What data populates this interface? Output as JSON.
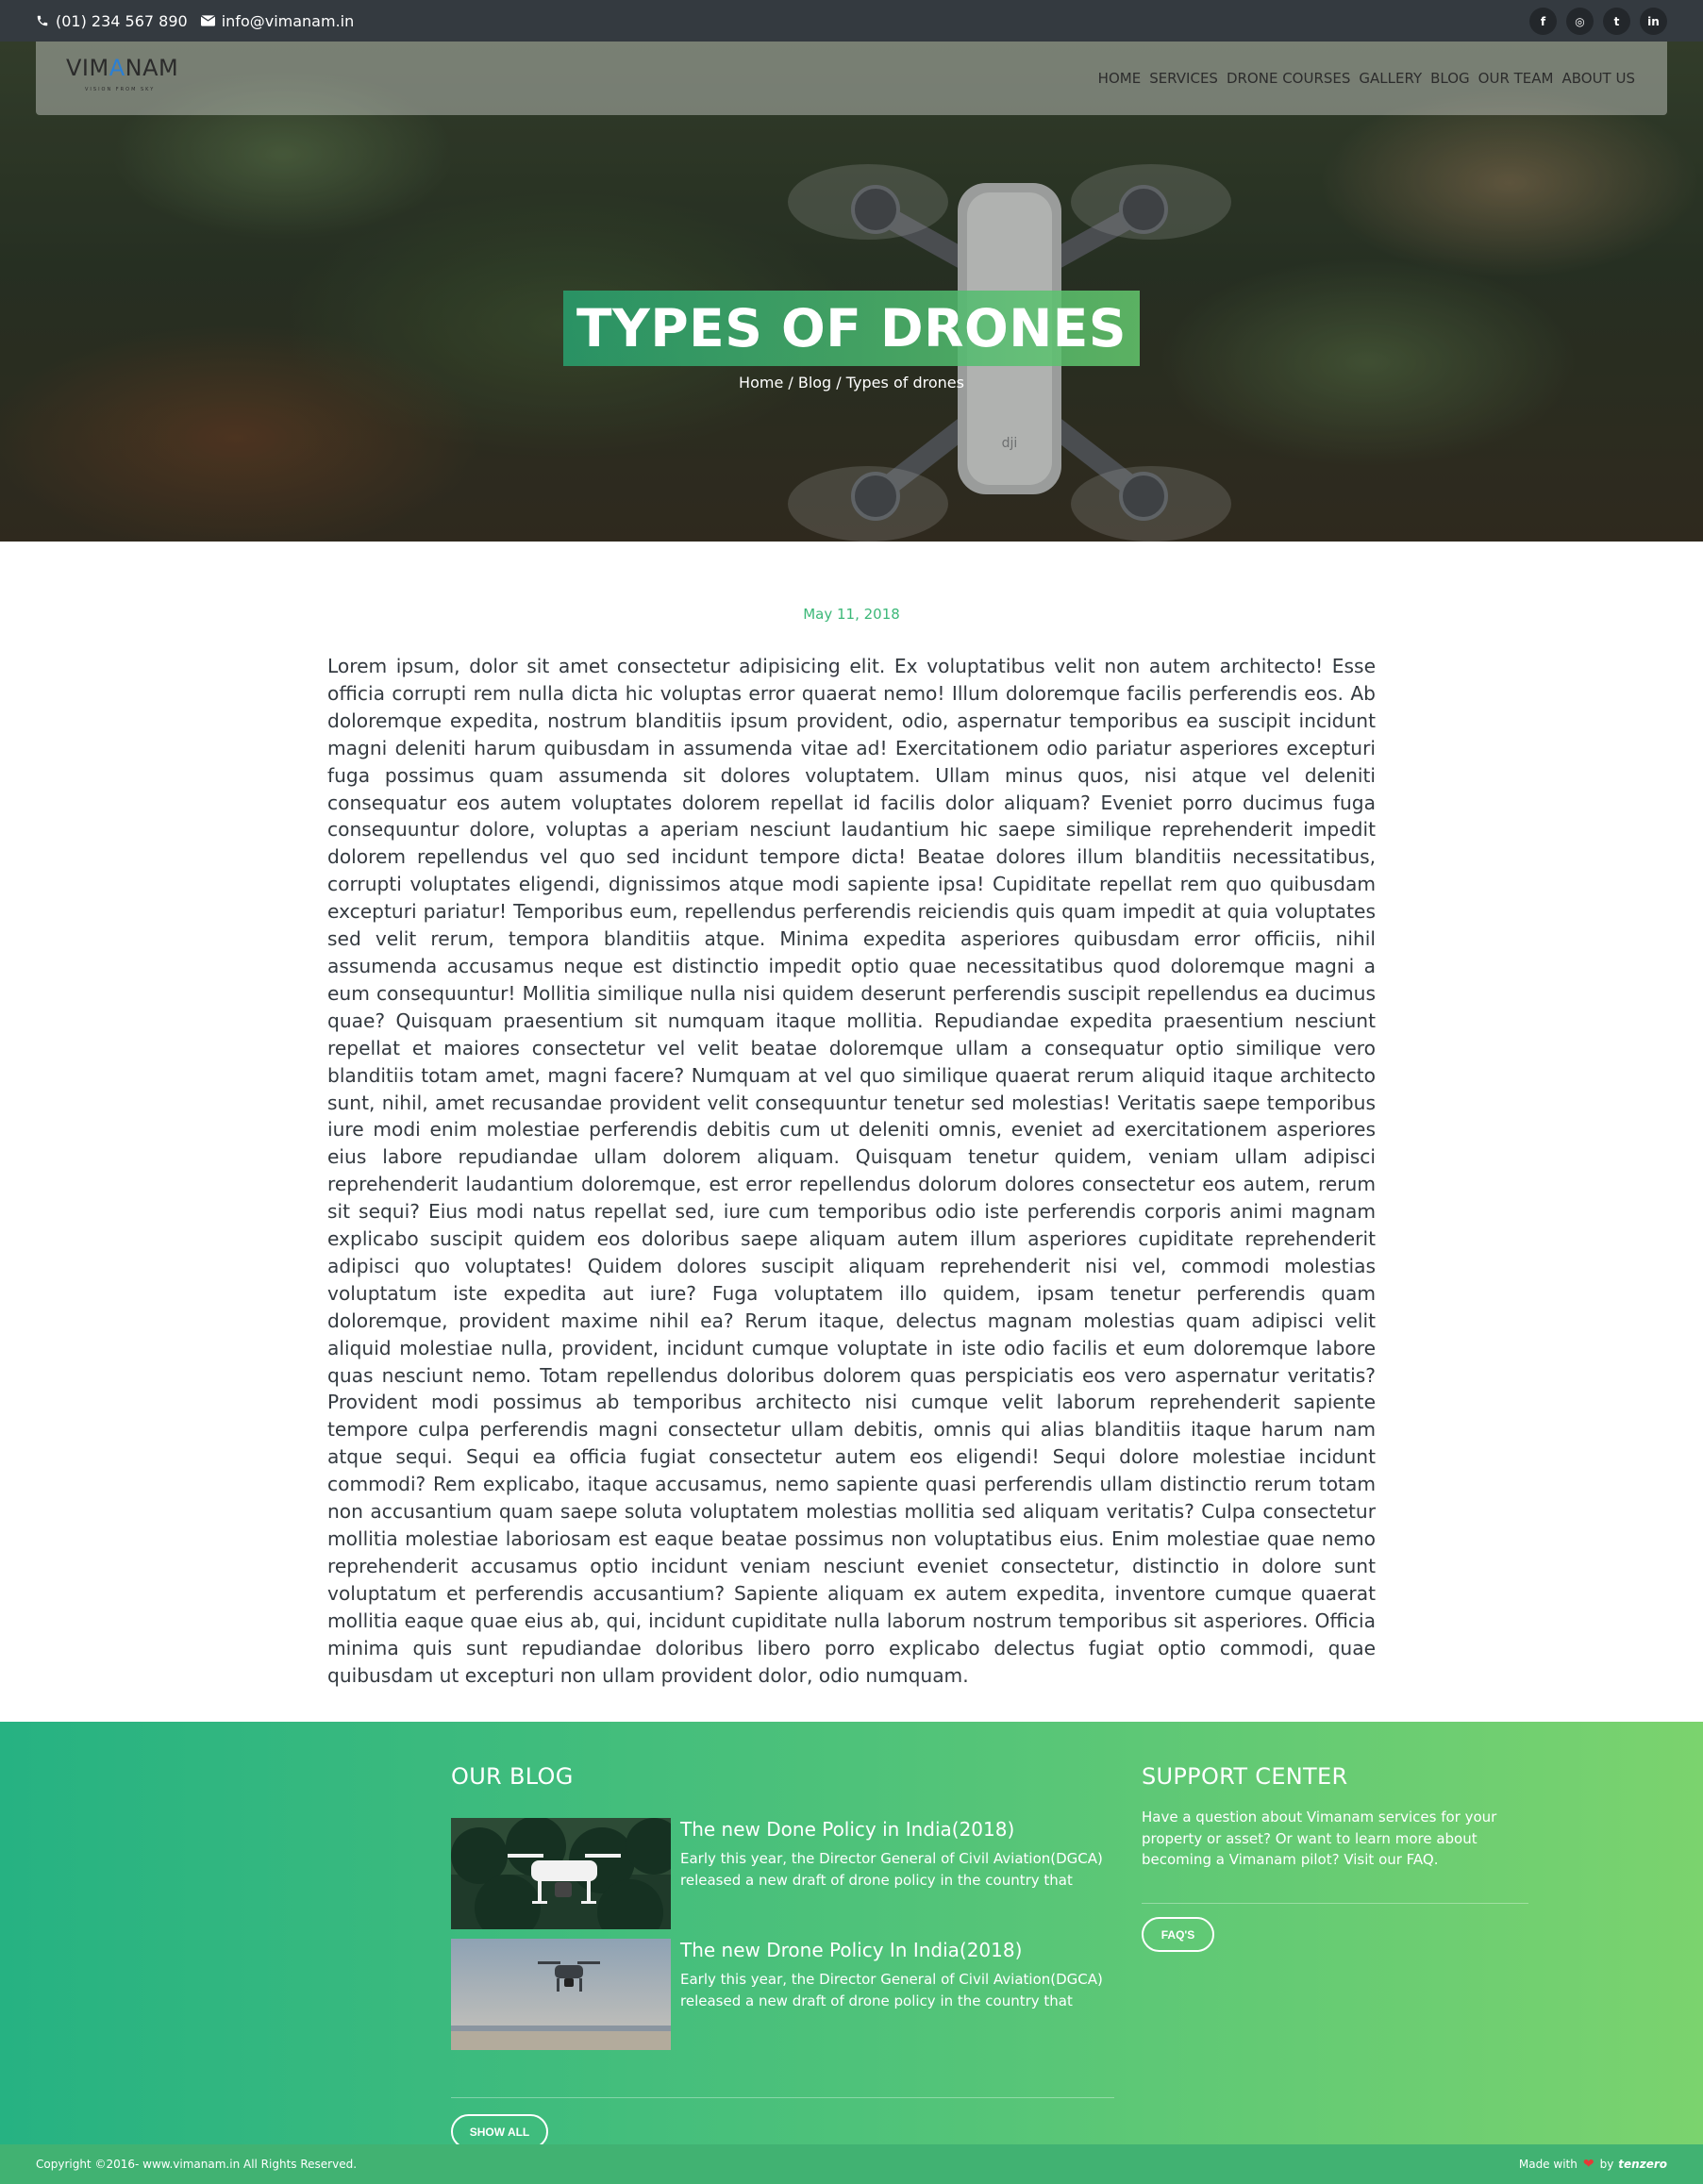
{
  "topbar": {
    "phone": "(01) 234 567 890",
    "email": "info@vimanam.in",
    "social": [
      {
        "icon": "facebook-icon",
        "glyph": "f"
      },
      {
        "icon": "instagram-icon",
        "glyph": "◎"
      },
      {
        "icon": "twitter-icon",
        "glyph": "t"
      },
      {
        "icon": "linkedin-icon",
        "glyph": "in"
      }
    ]
  },
  "brand": {
    "logo_text_left": "VIM",
    "logo_text_mid": "A",
    "logo_text_right": "NAM",
    "tagline": "VISION FROM SKY"
  },
  "nav": {
    "items": [
      "HOME",
      "SERVICES",
      "DRONE COURSES",
      "GALLERY",
      "BLOG",
      "OUR TEAM",
      "ABOUT US"
    ]
  },
  "hero": {
    "title": "TYPES OF DRONES",
    "breadcrumb": "Home / Blog / Types of drones"
  },
  "article": {
    "date": "May 11, 2018",
    "body": "Lorem ipsum, dolor sit amet consectetur adipisicing elit. Ex voluptatibus velit non autem architecto! Esse officia corrupti rem nulla dicta hic voluptas error quaerat nemo! Illum doloremque facilis perferendis eos. Ab doloremque expedita, nostrum blanditiis ipsum provident, odio, aspernatur temporibus ea suscipit incidunt magni deleniti harum quibusdam in assumenda vitae ad! Exercitationem odio pariatur asperiores excepturi fuga possimus quam assumenda sit dolores voluptatem. Ullam minus quos, nisi atque vel deleniti consequatur eos autem voluptates dolorem repellat id facilis dolor aliquam? Eveniet porro ducimus fuga consequuntur dolore, voluptas a aperiam nesciunt laudantium hic saepe similique reprehenderit impedit dolorem repellendus vel quo sed incidunt tempore dicta! Beatae dolores illum blanditiis necessitatibus, corrupti voluptates eligendi, dignissimos atque modi sapiente ipsa! Cupiditate repellat rem quo quibusdam excepturi pariatur! Temporibus eum, repellendus perferendis reiciendis quis quam impedit at quia voluptates sed velit rerum, tempora blanditiis atque. Minima expedita asperiores quibusdam error officiis, nihil assumenda accusamus neque est distinctio impedit optio quae necessitatibus quod doloremque magni a eum consequuntur! Mollitia similique nulla nisi quidem deserunt perferendis suscipit repellendus ea ducimus quae? Quisquam praesentium sit numquam itaque mollitia. Repudiandae expedita praesentium nesciunt repellat et maiores consectetur vel velit beatae doloremque ullam a consequatur optio similique vero blanditiis totam amet, magni facere? Numquam at vel quo similique quaerat rerum aliquid itaque architecto sunt, nihil, amet recusandae provident velit consequuntur tenetur sed molestias! Veritatis saepe temporibus iure modi enim molestiae perferendis debitis cum ut deleniti omnis, eveniet ad exercitationem asperiores eius labore repudiandae ullam dolorem aliquam. Quisquam tenetur quidem, veniam ullam adipisci reprehenderit laudantium doloremque, est error repellendus dolorum dolores consectetur eos autem, rerum sit sequi? Eius modi natus repellat sed, iure cum temporibus odio iste perferendis corporis animi magnam explicabo suscipit quidem eos doloribus saepe aliquam autem illum asperiores cupiditate reprehenderit adipisci quo voluptates! Quidem dolores suscipit aliquam reprehenderit nisi vel, commodi molestias voluptatum iste expedita aut iure? Fuga voluptatem illo quidem, ipsam tenetur perferendis quam doloremque, provident maxime nihil ea? Rerum itaque, delectus magnam molestias quam adipisci velit aliquid molestiae nulla, provident, incidunt cumque voluptate in iste odio facilis et eum doloremque labore quas nesciunt nemo. Totam repellendus doloribus dolorem quas perspiciatis eos vero aspernatur veritatis? Provident modi possimus ab temporibus architecto nisi cumque velit laborum reprehenderit sapiente tempore culpa perferendis magni consectetur ullam debitis, omnis qui alias blanditiis itaque harum nam atque sequi. Sequi ea officia fugiat consectetur autem eos eligendi! Sequi dolore molestiae incidunt commodi? Rem explicabo, itaque accusamus, nemo sapiente quasi perferendis ullam distinctio rerum totam non accusantium quam saepe soluta voluptatem molestias mollitia sed aliquam veritatis? Culpa consectetur mollitia molestiae laboriosam est eaque beatae possimus non voluptatibus eius. Enim molestiae quae nemo reprehenderit accusamus optio incidunt veniam nesciunt eveniet consectetur, distinctio in dolore sunt voluptatum et perferendis accusantium? Sapiente aliquam ex autem expedita, inventore cumque quaerat mollitia eaque quae eius ab, qui, incidunt cupiditate nulla laborum nostrum temporibus sit asperiores. Officia minima quis sunt repudiandae doloribus libero porro explicabo delectus fugiat optio commodi, quae quibusdam ut excepturi non ullam provident dolor, odio numquam."
  },
  "footer": {
    "blog": {
      "title": "OUR BLOG",
      "posts": [
        {
          "title": "The new Done Policy in India(2018)",
          "excerpt": "Early this year, the Director General of Civil Aviation(DGCA) released a new draft of drone policy in the country that"
        },
        {
          "title": "The new Drone Policy In India(2018)",
          "excerpt": "Early this year, the Director General of Civil Aviation(DGCA) released a new draft of drone policy in the country that"
        }
      ],
      "show_all": "SHOW ALL"
    },
    "support": {
      "title": "SUPPORT CENTER",
      "text": "Have a question about Vimanam services for your property or asset? Or want to learn more about becoming a Vimanam pilot? Visit our FAQ.",
      "faq_button": "FAQ'S"
    }
  },
  "bottom": {
    "copyright": "Copyright ©2016- www.vimanam.in All Rights Reserved.",
    "made_with": "Made with",
    "by": "by",
    "brand": "tenzero"
  },
  "colors": {
    "accent": "#3cb878",
    "topbar": "#343a40",
    "footer_start": "#26b282",
    "footer_end": "#7bd36e"
  }
}
